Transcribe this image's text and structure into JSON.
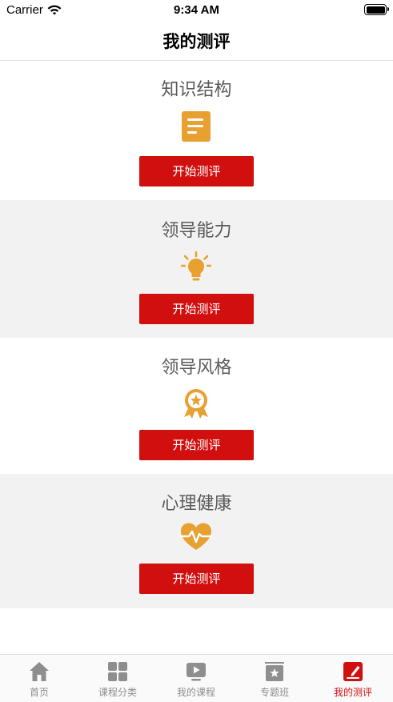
{
  "status_bar": {
    "carrier": "Carrier",
    "time": "9:34 AM"
  },
  "nav": {
    "title": "我的测评"
  },
  "sections": [
    {
      "title": "知识结构",
      "icon": "document-icon",
      "button": "开始测评"
    },
    {
      "title": "领导能力",
      "icon": "lightbulb-icon",
      "button": "开始测评"
    },
    {
      "title": "领导风格",
      "icon": "star-badge-icon",
      "button": "开始测评"
    },
    {
      "title": "心理健康",
      "icon": "heartbeat-icon",
      "button": "开始测评"
    }
  ],
  "tabs": [
    {
      "label": "首页",
      "icon": "home-icon"
    },
    {
      "label": "课程分类",
      "icon": "grid-icon"
    },
    {
      "label": "我的课程",
      "icon": "play-icon"
    },
    {
      "label": "专题班",
      "icon": "star-board-icon"
    },
    {
      "label": "我的测评",
      "icon": "edit-icon",
      "active": true
    }
  ],
  "colors": {
    "accent": "#d20f0f",
    "icon": "#e8a030",
    "tab_inactive": "#8e8e8e"
  }
}
